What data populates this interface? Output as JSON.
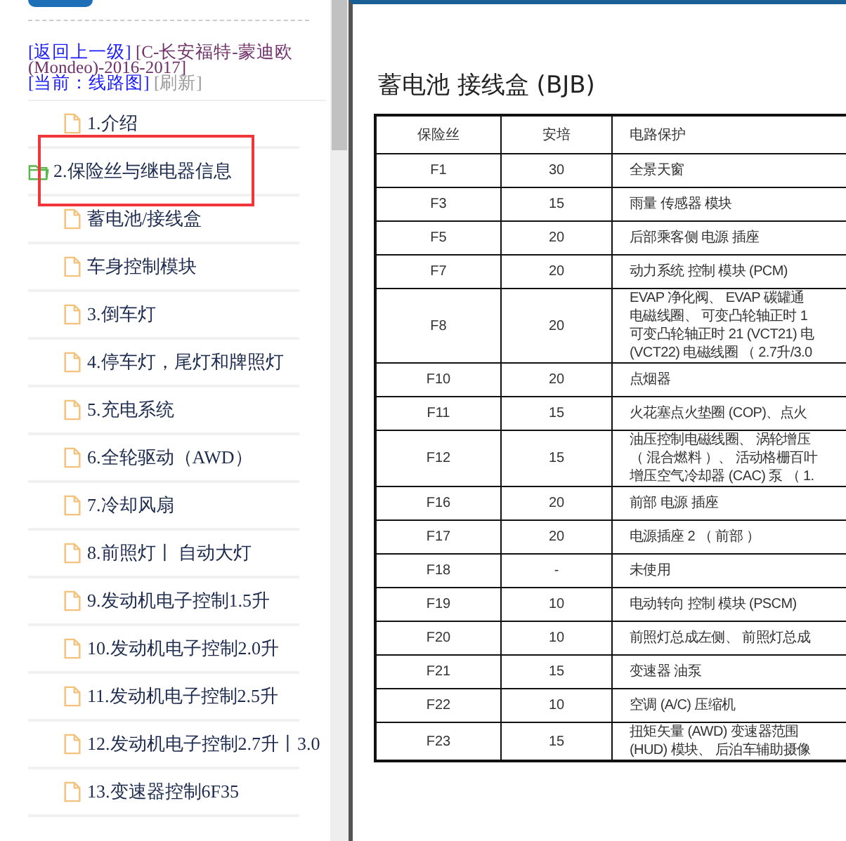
{
  "sidebar": {
    "header": {
      "back_link": "[返回上一级]",
      "path": "[C-长安福特-蒙迪欧(Mondeo)-2016-2017]",
      "current_link": "[当前：线路图]",
      "refresh": "[刷新]"
    },
    "items": [
      {
        "label": "1.介绍",
        "expanded": false,
        "annotated": false
      },
      {
        "label": "2.保险丝与继电器信息",
        "expanded": true,
        "annotated": true,
        "children": [
          {
            "label": "蓄电池/接线盒",
            "expanded": false,
            "annotated": false
          },
          {
            "label": "车身控制模块",
            "expanded": false,
            "annotated": false
          }
        ]
      },
      {
        "label": "3.倒车灯",
        "expanded": false,
        "annotated": false
      },
      {
        "label": "4.停车灯，尾灯和牌照灯",
        "expanded": false,
        "annotated": false
      },
      {
        "label": "5.充电系统",
        "expanded": false,
        "annotated": false
      },
      {
        "label": "6.全轮驱动（AWD）",
        "expanded": false,
        "annotated": false
      },
      {
        "label": "7.冷却风扇",
        "expanded": false,
        "annotated": false
      },
      {
        "label": "8.前照灯丨 自动大灯",
        "expanded": false,
        "annotated": false
      },
      {
        "label": "9.发动机电子控制1.5升",
        "expanded": false,
        "annotated": false
      },
      {
        "label": "10.发动机电子控制2.0升",
        "expanded": false,
        "annotated": false
      },
      {
        "label": "11.发动机电子控制2.5升",
        "expanded": false,
        "annotated": false
      },
      {
        "label": "12.发动机电子控制2.7升丨3.0",
        "expanded": false,
        "annotated": false
      },
      {
        "label": "13.变速器控制6F35",
        "expanded": false,
        "annotated": false
      }
    ]
  },
  "document": {
    "title": "蓄电池 接线盒 (BJB)",
    "table": {
      "columns": [
        "保险丝",
        "安培",
        "电路保护"
      ],
      "rows": [
        {
          "fuse": "F1",
          "amps": "30",
          "circuit": [
            "全景天窗"
          ]
        },
        {
          "fuse": "F3",
          "amps": "15",
          "circuit": [
            "雨量 传感器 模块"
          ]
        },
        {
          "fuse": "F5",
          "amps": "20",
          "circuit": [
            "后部乘客侧 电源 插座"
          ]
        },
        {
          "fuse": "F7",
          "amps": "20",
          "circuit": [
            "动力系统 控制 模块 (PCM)"
          ]
        },
        {
          "fuse": "F8",
          "amps": "20",
          "circuit": [
            "EVAP 净化阀、 EVAP 碳罐通",
            "电磁线圈、 可变凸轮轴正时 1",
            "可变凸轮轴正时 21 (VCT21) 电",
            "(VCT22) 电磁线圈 （ 2.7升/3.0"
          ]
        },
        {
          "fuse": "F10",
          "amps": "20",
          "circuit": [
            "点烟器"
          ]
        },
        {
          "fuse": "F11",
          "amps": "15",
          "circuit": [
            "火花塞点火垫圈 (COP)、点火"
          ]
        },
        {
          "fuse": "F12",
          "amps": "15",
          "circuit": [
            "油压控制电磁线圈、 涡轮增压",
            "（ 混合燃料 ）、 活动格栅百叶",
            "增压空气冷却器 (CAC) 泵 （ 1."
          ]
        },
        {
          "fuse": "F16",
          "amps": "20",
          "circuit": [
            "前部 电源 插座"
          ]
        },
        {
          "fuse": "F17",
          "amps": "20",
          "circuit": [
            "电源插座 2 （ 前部 ）"
          ]
        },
        {
          "fuse": "F18",
          "amps": "-",
          "circuit": [
            "未使用"
          ]
        },
        {
          "fuse": "F19",
          "amps": "10",
          "circuit": [
            "电动转向 控制 模块 (PSCM)"
          ]
        },
        {
          "fuse": "F20",
          "amps": "10",
          "circuit": [
            "前照灯总成左侧、 前照灯总成"
          ]
        },
        {
          "fuse": "F21",
          "amps": "15",
          "circuit": [
            "变速器 油泵"
          ]
        },
        {
          "fuse": "F22",
          "amps": "10",
          "circuit": [
            "空调 (A/C) 压缩机"
          ]
        },
        {
          "fuse": "F23",
          "amps": "15",
          "circuit": [
            "扭矩矢量 (AWD) 变速器范围",
            "(HUD) 模块、 后泊车辅助摄像"
          ]
        }
      ]
    }
  }
}
